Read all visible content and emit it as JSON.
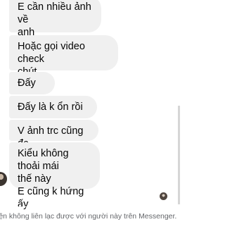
{
  "conversation": {
    "messages": [
      {
        "text": "E cần nhiều ảnh về\nanh"
      },
      {
        "text": "Hoặc gọi video check\nchút"
      },
      {
        "text": "Đấy"
      },
      {
        "text": "Đấy là k ổn rồi"
      },
      {
        "text": "V ảnh trc cũng đc"
      },
      {
        "text": "Kiểu không thoải mái\nthế này\nE cũng k hứng ấy"
      }
    ]
  },
  "footer": {
    "notice": "iện không liên lạc được với người này trên Messenger."
  }
}
